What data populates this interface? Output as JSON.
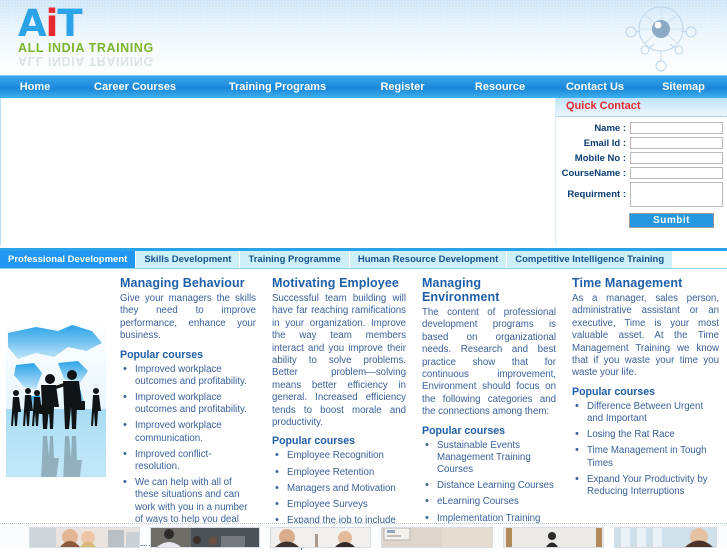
{
  "site": {
    "logo_a": "A",
    "logo_i": "i",
    "logo_t": "T",
    "tagline": "ALL INDIA TRAINING",
    "accent_blue": "#2aa3e8",
    "accent_red": "#e8282f",
    "accent_green": "#7ab52b"
  },
  "nav": {
    "items": [
      {
        "label": "Home"
      },
      {
        "label": "Career Courses"
      },
      {
        "label": "Training Programs"
      },
      {
        "label": "Register"
      },
      {
        "label": "Resource"
      },
      {
        "label": "Contact Us"
      },
      {
        "label": "Sitemap"
      }
    ]
  },
  "quick_contact": {
    "title": "Quick Contact",
    "fields": [
      {
        "label": "Name :",
        "value": "",
        "placeholder": ""
      },
      {
        "label": "Email Id :",
        "value": "",
        "placeholder": ""
      },
      {
        "label": "Mobile No :",
        "value": "",
        "placeholder": ""
      },
      {
        "label": "CourseName :",
        "value": "",
        "placeholder": ""
      }
    ],
    "textarea": {
      "label": "Requirment :",
      "value": "",
      "placeholder": ""
    },
    "submit_label": "Sumbit"
  },
  "tabs": [
    {
      "label": "Professional Development",
      "active": true
    },
    {
      "label": "Skills Development",
      "active": false
    },
    {
      "label": "Training Programme",
      "active": false
    },
    {
      "label": "Human Resource Development",
      "active": false
    },
    {
      "label": "Competitive Intelligence Training",
      "active": false
    }
  ],
  "columns": [
    {
      "title": "Managing Behaviour",
      "body": "Give your managers the skills they need to improve performance, enhance your business.",
      "courses_heading": "Popular courses",
      "courses": [
        "Improved workplace outcomes and profitability.",
        "Improved workplace outcomes and profitability.",
        "Improved workplace communication.",
        "Improved conflict-resolution.",
        "We can help with all of these situations and can work with you in a number of ways to help you deal successfully with them. We can..."
      ]
    },
    {
      "title": "Motivating Employee",
      "body": "Successful team building will have far reaching ramifications in your organization. Improve the way team members interact and you improve their ability to solve problems. Better problem—solving means better efficiency in general. Increased efficiency tends to boost morale and productivity.",
      "courses_heading": "Popular courses",
      "courses": [
        "Employee Recognition",
        "Employee Retention",
        "Managers and Motivation",
        "Employee Surveys",
        "Expand the job to include new, higher level responsibilities."
      ]
    },
    {
      "title": "Managing Environment",
      "body": "The content of professional development programs is based on organizational needs. Research and best practice show that for continuous improvement, Environment should focus on the following categories and the connections among them:",
      "courses_heading": "Popular courses",
      "courses": [
        "Sustainable Events Management Training Courses",
        "Distance Learning Courses",
        "eLearning Courses",
        "Implementation Training Courses"
      ]
    },
    {
      "title": "Time Management",
      "body": "As a manager, sales person, administrative assistant or an executive, Time is your most valuable asset. At the Time Management Training we know that if you waste your time you waste your life.",
      "courses_heading": "Popular courses",
      "courses": [
        "Difference Between Urgent and Important",
        "Losing the Rat Race",
        "Time Management in Tough Times",
        "Expand Your Productivity by Reducing Interruptions"
      ]
    }
  ],
  "sidebar_image": {
    "alt": "business-people-world-map"
  },
  "footer_thumbs": [
    {
      "alt": "thumb-women-meeting"
    },
    {
      "alt": "thumb-office-team"
    },
    {
      "alt": "thumb-call-center"
    },
    {
      "alt": "thumb-whiteboard"
    },
    {
      "alt": "thumb-corridor"
    },
    {
      "alt": "thumb-portrait"
    }
  ]
}
